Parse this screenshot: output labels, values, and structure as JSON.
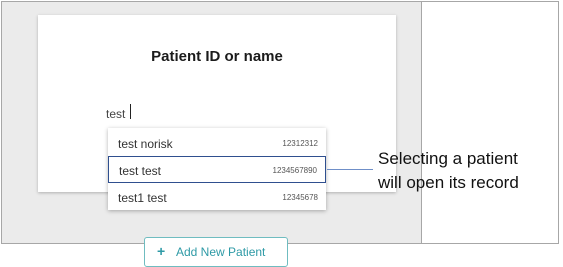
{
  "dialog": {
    "title": "Patient ID or name"
  },
  "search": {
    "value": "test"
  },
  "results": [
    {
      "name": "test norisk",
      "id": "12312312",
      "selected": false
    },
    {
      "name": "test test",
      "id": "1234567890",
      "selected": true
    },
    {
      "name": "test1 test",
      "id": "12345678",
      "selected": false
    }
  ],
  "add_button": {
    "icon": "plus-icon",
    "label": "Add New Patient"
  },
  "annotation": {
    "line1": "Selecting a patient",
    "line2": "will open its record"
  },
  "colors": {
    "background": "#ebebeb",
    "selected_border": "#2f4f8f",
    "accent": "#2e9aa6"
  }
}
